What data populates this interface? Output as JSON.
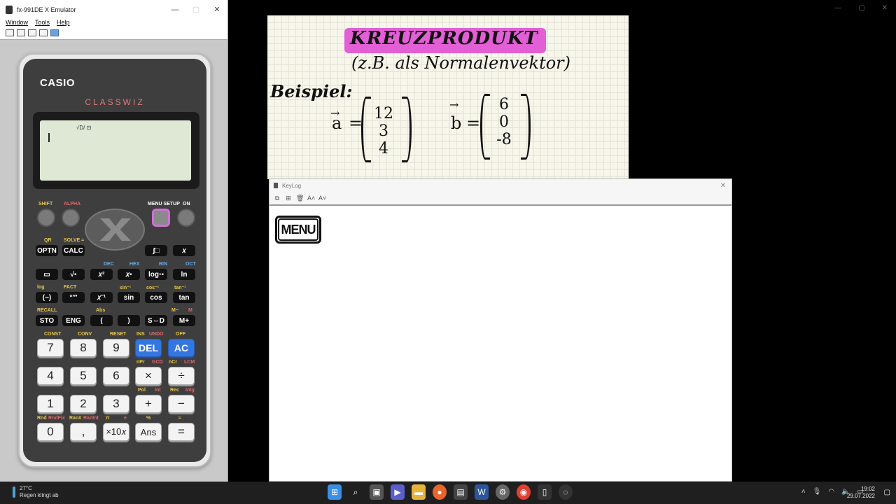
{
  "emulator": {
    "title": "fx-991DE X Emulator",
    "menu": [
      "Window",
      "Tools",
      "Help"
    ],
    "calculator": {
      "brand": "CASIO",
      "model": "CLASSWIZ",
      "status": "√D/ ⊡",
      "keys": {
        "shift": "SHIFT",
        "alpha": "ALPHA",
        "menu_setup": "MENU SETUP",
        "on": "ON",
        "optn": "OPTN",
        "calc": "CALC",
        "intg": "∫□",
        "x": "𝑥",
        "frac": "▭",
        "sqrt": "√▪",
        "sq": "𝑥²",
        "pow": "𝑥▪",
        "log": "log▫▪",
        "ln": "ln",
        "neg": "(−)",
        "deg": "°′″",
        "inv": "𝑥⁻¹",
        "sin": "sin",
        "cos": "cos",
        "tan": "tan",
        "sto": "STO",
        "eng": "ENG",
        "lpar": "(",
        "rpar": ")",
        "sd": "S⇔D",
        "mplus": "M+",
        "n7": "7",
        "n8": "8",
        "n9": "9",
        "del": "DEL",
        "ac": "AC",
        "n4": "4",
        "n5": "5",
        "n6": "6",
        "mul": "×",
        "div": "÷",
        "n1": "1",
        "n2": "2",
        "n3": "3",
        "plus": "+",
        "minus": "−",
        "n0": "0",
        "comma": ",",
        "exp": "×10𝑥",
        "ans": "Ans",
        "eq": "="
      },
      "labels": {
        "qr": "QR",
        "solve": "SOLVE =",
        "recall": "RECALL",
        "abs": "Abs",
        "const": "CONST",
        "conv": "CONV",
        "reset": "RESET",
        "ins": "INS",
        "undo": "UNDO",
        "off": "OFF",
        "npr": "nPr",
        "gcd": "GCD",
        "ncr": "nCr",
        "lcm": "LCM",
        "pol": "Pol",
        "int": "Int",
        "rec": "Rec",
        "intg": "Intg",
        "rnd": "Rnd",
        "rndfix": "RndFix",
        "ran": "Ran#",
        "ranint": "RanInt",
        "pi": "π",
        "e": "e",
        "pct": "%",
        "approx": "≈",
        "log_a": "log",
        "fact": "FACT",
        "dec": "DEC",
        "hex": "HEX",
        "bin": "BIN",
        "oct": "OCT",
        "sin_inv": "sin⁻¹",
        "cos_inv": "cos⁻¹",
        "tan_inv": "tan⁻¹",
        "m_minus": "M−",
        "m": "M"
      }
    }
  },
  "board": {
    "title": "KREUZPRODUKT",
    "subtitle": "(z.B. als Normalenvektor)",
    "example_label": "Beispiel:",
    "vector_a": {
      "name": "a",
      "values": [
        "12",
        "3",
        "4"
      ]
    },
    "vector_b": {
      "name": "b",
      "values": [
        "6",
        "0",
        "-8"
      ]
    }
  },
  "keylog": {
    "title": "KeyLog",
    "last_key": "MENU"
  },
  "taskbar": {
    "weather_temp": "27°C",
    "weather_text": "Regen klingt ab",
    "time": "19:02",
    "date": "29.07.2022"
  }
}
